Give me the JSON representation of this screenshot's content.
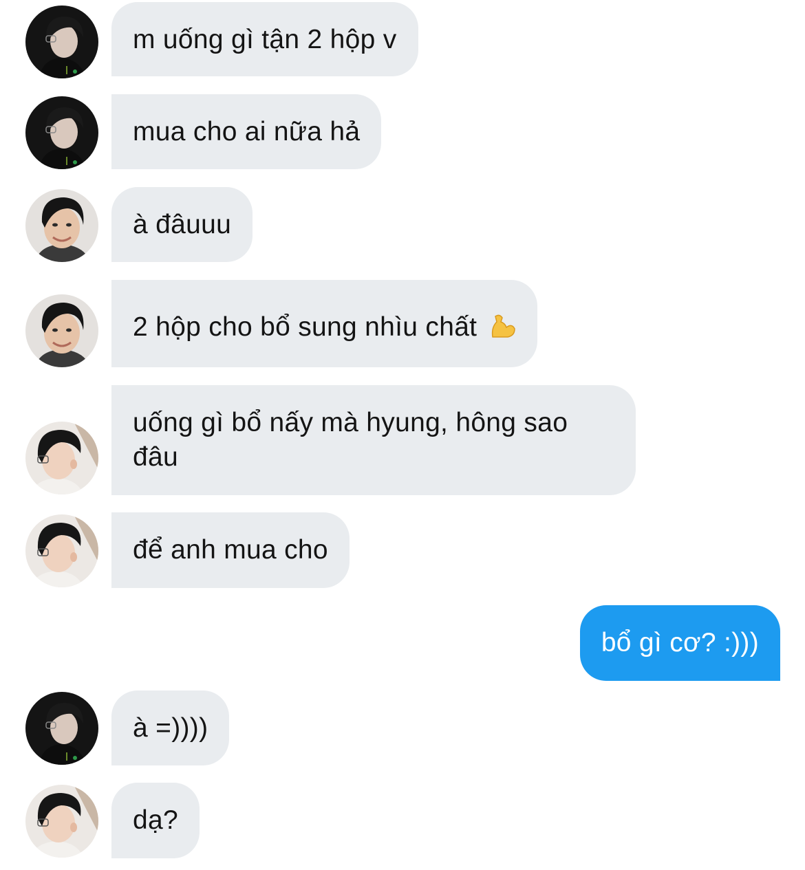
{
  "conversation": {
    "messages": [
      {
        "text": "m uống gì tận 2 hộp v",
        "avatar": "avatar-dark-shirt-glasses"
      },
      {
        "text": "mua cho ai nữa hả",
        "avatar": "avatar-dark-shirt-glasses"
      },
      {
        "text": "à đâuuu",
        "avatar": "avatar-smiling-man"
      },
      {
        "text": "2 hộp cho bổ sung nhìu chất",
        "emoji": "flexed-biceps-icon",
        "avatar": "avatar-smiling-man"
      },
      {
        "text": "uống gì bổ nấy mà hyung, hông sao đâu",
        "avatar": "avatar-boy-glasses-profile"
      },
      {
        "text": "để anh mua cho",
        "avatar": "avatar-boy-glasses-profile"
      },
      {
        "text": "bổ gì cơ? :)))",
        "direction": "sent"
      },
      {
        "text": "à =))))",
        "avatar": "avatar-dark-shirt-glasses"
      },
      {
        "text": "dạ?",
        "avatar": "avatar-boy-glasses-profile"
      }
    ]
  },
  "colors": {
    "received_bubble": "#e9ecef",
    "sent_bubble": "#1d9bf0",
    "received_text": "#141414",
    "sent_text": "#ffffff"
  }
}
